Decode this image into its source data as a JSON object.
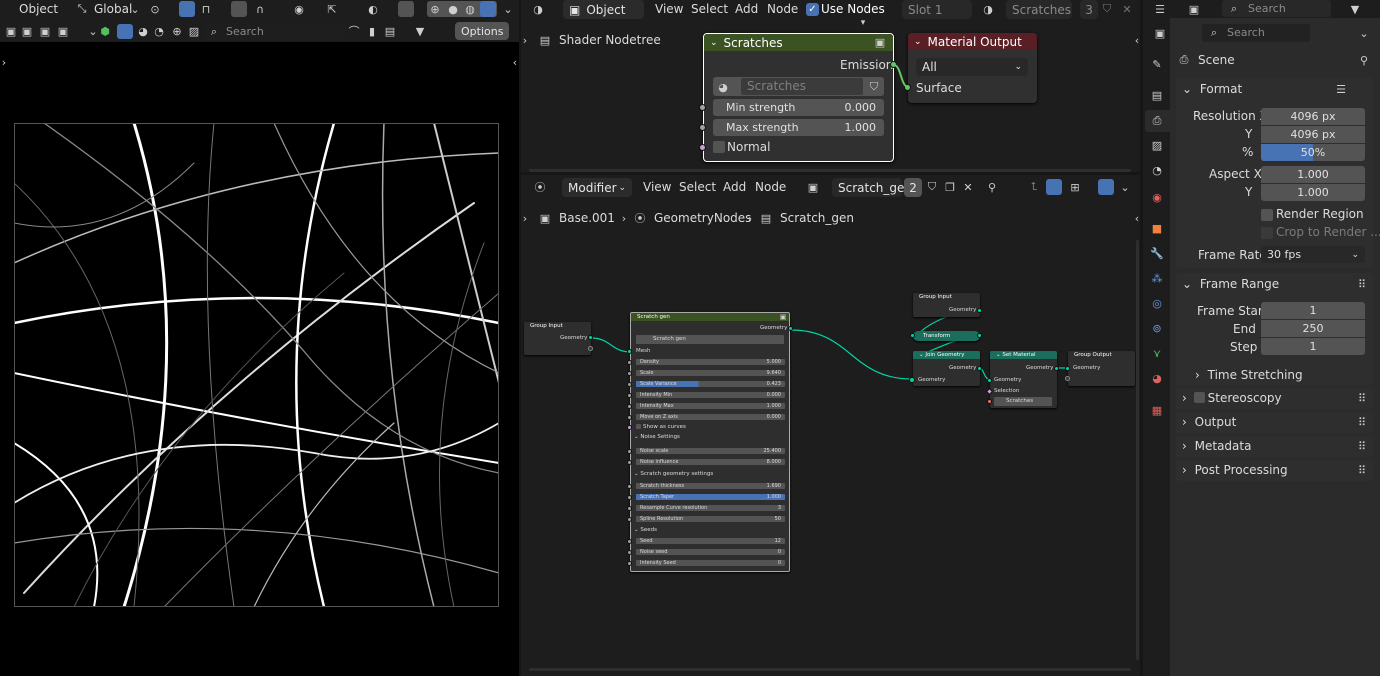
{
  "viewport": {
    "object_menu": "Object",
    "transform": "Global",
    "search_placeholder": "Search",
    "options": "Options"
  },
  "shader_editor": {
    "menus": [
      "View",
      "Select",
      "Add",
      "Node"
    ],
    "use_nodes": "Use Nodes",
    "slot": "Slot 1",
    "material": "Scratches",
    "material_users": "3",
    "breadcrumb": "Shader Nodetree",
    "scratches_node": {
      "title": "Scratches",
      "output": "Emission",
      "group": "Scratches",
      "min_label": "Min strength",
      "min_value": "0.000",
      "max_label": "Max strength",
      "max_value": "1.000",
      "normal": "Normal"
    },
    "material_output": {
      "title": "Material Output",
      "target": "All",
      "input": "Surface"
    }
  },
  "geo_editor": {
    "mode": "Modifier",
    "menus": [
      "View",
      "Select",
      "Add",
      "Node"
    ],
    "tree": "Scratch_gen",
    "tree_users": "2",
    "breadcrumb": [
      "Base.001",
      "GeometryNodes",
      "Scratch_gen"
    ],
    "group_input": {
      "title": "Group Input",
      "socket": "Geometry"
    },
    "scratch_node": {
      "title": "Scratch gen",
      "output": "Geometry",
      "group": "Scratch gen",
      "mesh": "Mesh",
      "rows": [
        {
          "label": "Density",
          "value": "5.000"
        },
        {
          "label": "Scale",
          "value": "9.640"
        },
        {
          "label": "Scale Variance",
          "value": "0.423"
        },
        {
          "label": "Intensity Min",
          "value": "0.000"
        },
        {
          "label": "Intensity Max",
          "value": "1.000"
        },
        {
          "label": "Move on Z axis",
          "value": "0.000"
        }
      ],
      "show_curves": "Show as curves",
      "noise_header": "Noise Settings",
      "noise_rows": [
        {
          "label": "Noise scale",
          "value": "25.400"
        },
        {
          "label": "Noise influence",
          "value": "8.000"
        }
      ],
      "geo_header": "Scratch geometry settings",
      "geo_rows": [
        {
          "label": "Scratch thickness",
          "value": "1.690"
        },
        {
          "label": "Scratch Taper",
          "value": "1.000"
        },
        {
          "label": "Resample Curve resolution",
          "value": "3"
        },
        {
          "label": "Spline Resolution",
          "value": "50"
        }
      ],
      "seeds_header": "Seeds",
      "seed_rows": [
        {
          "label": "Seed",
          "value": "12"
        },
        {
          "label": "Noise seed",
          "value": "0"
        },
        {
          "label": "Intensity Seed",
          "value": "0"
        }
      ]
    },
    "group_input2": {
      "title": "Group Input",
      "socket": "Geometry"
    },
    "transform": "Transform Geometr...",
    "join": {
      "title": "Join Geometry",
      "out": "Geometry",
      "in": "Geometry"
    },
    "set_material": {
      "title": "Set Material",
      "out": "Geometry",
      "in": "Geometry",
      "selection": "Selection",
      "material": "Scratches"
    },
    "group_output": {
      "title": "Group Output",
      "socket": "Geometry"
    }
  },
  "properties": {
    "search_placeholder": "Search",
    "scene": "Scene",
    "format_title": "Format",
    "res_x_label": "Resolution X",
    "res_x": "4096 px",
    "res_y_label": "Y",
    "res_y": "4096 px",
    "pct_label": "%",
    "pct": "50%",
    "pct_fraction": 0.5,
    "aspect_x_label": "Aspect X",
    "aspect_x": "1.000",
    "aspect_y_label": "Y",
    "aspect_y": "1.000",
    "render_region": "Render Region",
    "crop": "Crop to Render ...",
    "frame_rate_label": "Frame Rate",
    "frame_rate": "30 fps",
    "frame_range_title": "Frame Range",
    "start_label": "Frame Start",
    "start": "1",
    "end_label": "End",
    "end": "250",
    "step_label": "Step",
    "step": "1",
    "time_stretching": "Time Stretching",
    "sections": [
      "Stereoscopy",
      "Output",
      "Metadata",
      "Post Processing"
    ]
  },
  "colors": {
    "scratches_header": "#3b5222",
    "material_output_header": "#5a1f24",
    "geo_header": "#1b6e5b",
    "group_header": "#2e2e2e",
    "accent": "#4772b3",
    "link": "#00d6a3"
  }
}
